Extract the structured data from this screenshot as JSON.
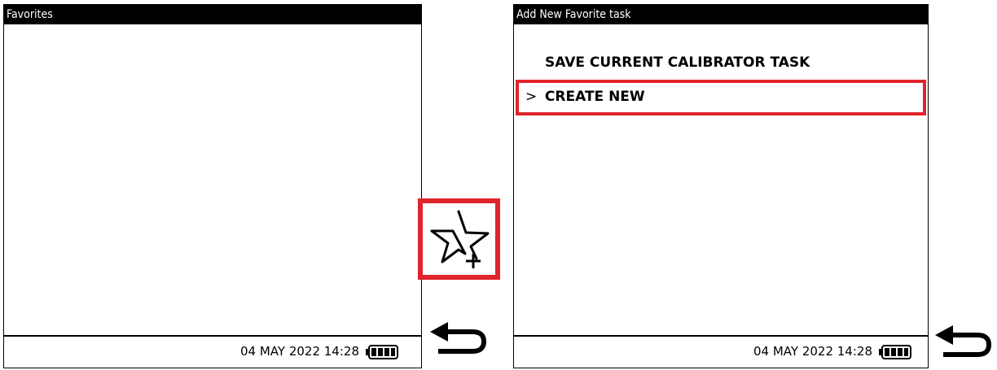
{
  "left_screen": {
    "title": "Favorites",
    "datetime": "04 MAY 2022 14:28",
    "battery_icon": "battery-full-icon"
  },
  "favorite_add_button": {
    "icon": "star-plus-icon",
    "highlight_color": "#e0242c"
  },
  "right_screen": {
    "title": "Add New Favorite task",
    "menu": [
      {
        "label": "SAVE CURRENT CALIBRATOR TASK",
        "selected": false
      },
      {
        "label": "CREATE NEW",
        "selected": true,
        "indicator": ">"
      }
    ],
    "datetime": "04 MAY 2022 14:28",
    "battery_icon": "battery-full-icon"
  },
  "back_buttons": [
    {
      "icon": "back-arrow-icon"
    },
    {
      "icon": "back-arrow-icon"
    }
  ]
}
